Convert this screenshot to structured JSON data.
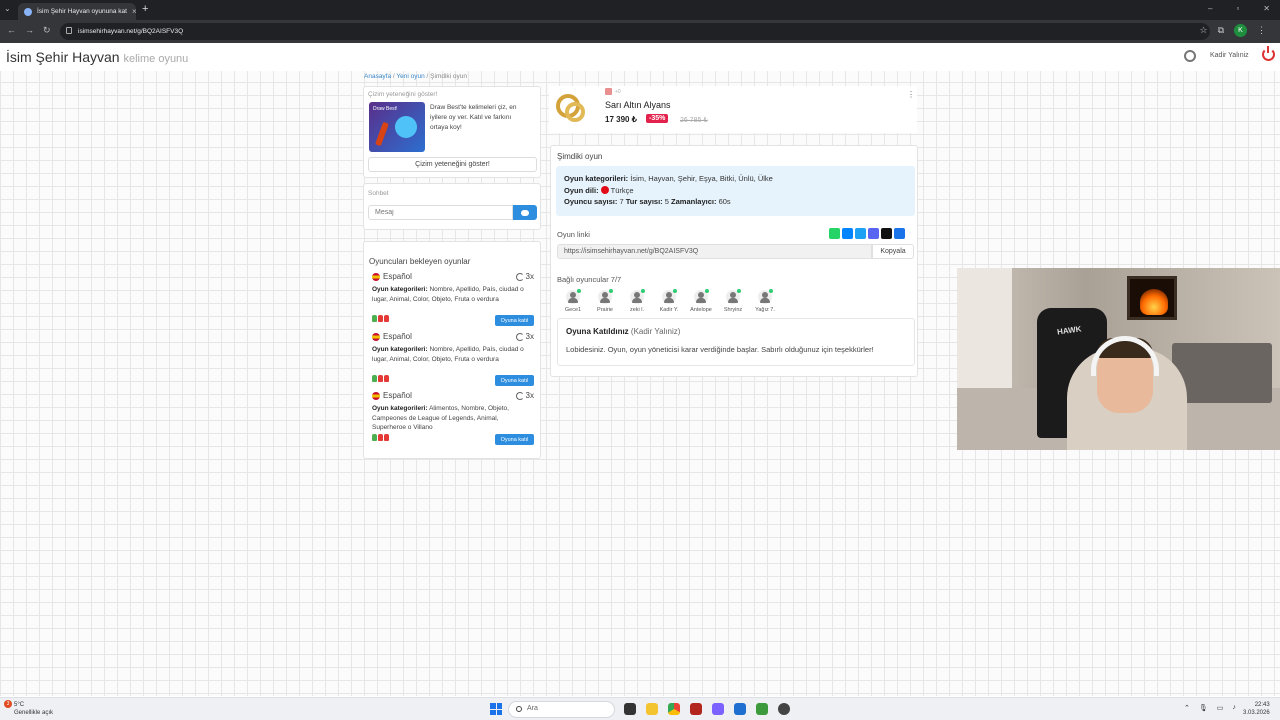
{
  "browser": {
    "tab_title": "İsim Şehir Hayvan oyununa kat",
    "url": "isimsehirhayvan.net/g/BQ2AISFV3Q",
    "profile_initial": "K"
  },
  "site": {
    "title": "İsim Şehir Hayvan",
    "subtitle": "kelime oyunu",
    "username": "Kadir Yalıniz"
  },
  "breadcrumb": {
    "home": "Anasayfa",
    "new_game": "Yeni oyun",
    "current": "Şimdiki oyun"
  },
  "drawing": {
    "card_title": "Çizim yeteneğini göster!",
    "thumb_text": "Draw Best!",
    "description": "Draw Best'te kelimeleri çiz, en iyilere oy ver. Katıl ve farkını ortaya koy!",
    "button": "Çizim yeteneğini göster!"
  },
  "chat": {
    "title": "Sohbet",
    "placeholder": "Mesaj"
  },
  "lobby": {
    "title": "Oyuncuları bekleyen oyunlar",
    "join_label": "Oyuna katıl",
    "categories_label": "Oyun kategorileri:",
    "games": [
      {
        "language": "Español",
        "rounds": "3x",
        "categories": "Nombre, Apellido, País, ciudad o lugar, Animal, Color, Objeto, Fruta o verdura"
      },
      {
        "language": "Español",
        "rounds": "3x",
        "categories": "Nombre, Apellido, País, ciudad o lugar, Animal, Color, Objeto, Fruta o verdura"
      },
      {
        "language": "Español",
        "rounds": "3x",
        "categories": "Alimentos, Nombre, Objeto, Campeones de League of Legends, Animal, Superheroe o Villano"
      }
    ]
  },
  "ad": {
    "badge": "+0",
    "title": "Sarı Altın Alyans",
    "price": "17 390 ₺",
    "discount": "-35%",
    "old_price": "26 785 ₺"
  },
  "current_game": {
    "title": "Şimdiki oyun",
    "categories_label": "Oyun kategorileri:",
    "categories": "İsim, Hayvan, Şehir, Eşya, Bitki, Ünlü, Ülke",
    "language_label": "Oyun dili:",
    "language": "Türkçe",
    "players_label": "Oyuncu sayısı:",
    "players": "7",
    "rounds_label": "Tur sayısı:",
    "rounds": "5",
    "timer_label": "Zamanlayıcı:",
    "timer": "60s",
    "link_label": "Oyun linki",
    "link": "https://isimsehirhayvan.net/g/BQ2AISFV3Q",
    "copy_button": "Kopyala",
    "connected_label": "Bağlı oyuncular 7/7",
    "player_names": [
      "Gece1",
      "Prairie",
      "zeki l.",
      "Kadir Y.",
      "Antelope",
      "Shryinz",
      "Yağız 7."
    ],
    "joined_title": "Oyuna Katıldınız",
    "joined_name": "(Kadir Yalıniz)",
    "joined_message": "Lobidesiniz. Oyun, oyun yöneticisi karar verdiğinde başlar. Sabırlı olduğunuz için teşekkürler!"
  },
  "webcam": {
    "chair_text": "HAWK"
  },
  "taskbar": {
    "weather_temp": "5°C",
    "weather_desc": "Genellikle açık",
    "weather_badge": "3",
    "search": "Ara",
    "time": "22:43",
    "date": "3.03.2026"
  }
}
